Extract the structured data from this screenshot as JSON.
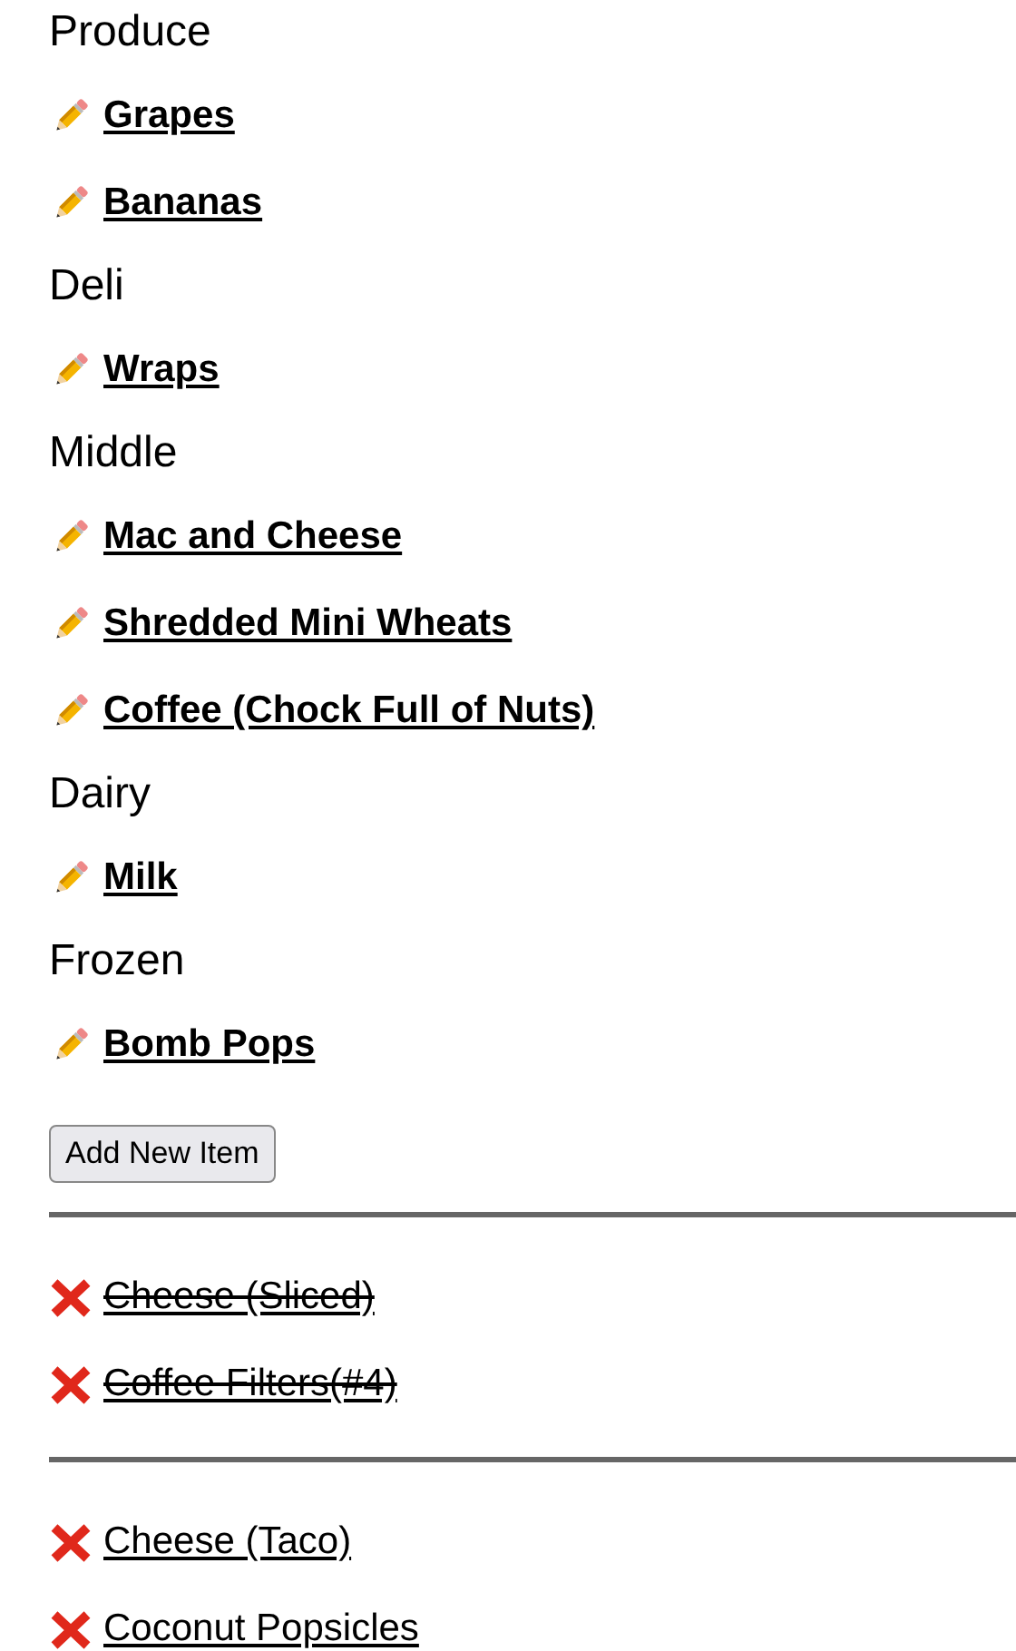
{
  "categories": [
    {
      "name": "Produce",
      "items": [
        {
          "label": "Grapes"
        },
        {
          "label": "Bananas"
        }
      ]
    },
    {
      "name": "Deli",
      "items": [
        {
          "label": "Wraps"
        }
      ]
    },
    {
      "name": "Middle",
      "items": [
        {
          "label": "Mac and Cheese"
        },
        {
          "label": "Shredded Mini Wheats"
        },
        {
          "label": "Coffee (Chock Full of Nuts)"
        }
      ]
    },
    {
      "name": "Dairy",
      "items": [
        {
          "label": "Milk"
        }
      ]
    },
    {
      "name": "Frozen",
      "items": [
        {
          "label": "Bomb Pops"
        }
      ]
    }
  ],
  "add_button": "Add New Item",
  "removed_lists": [
    [
      {
        "label": "Cheese (Sliced)",
        "struck": true
      },
      {
        "label": "Coffee Filters(#4)",
        "struck": true
      }
    ],
    [
      {
        "label": "Cheese (Taco)",
        "struck": false
      },
      {
        "label": "Coconut Popsicles",
        "struck": false
      }
    ]
  ]
}
